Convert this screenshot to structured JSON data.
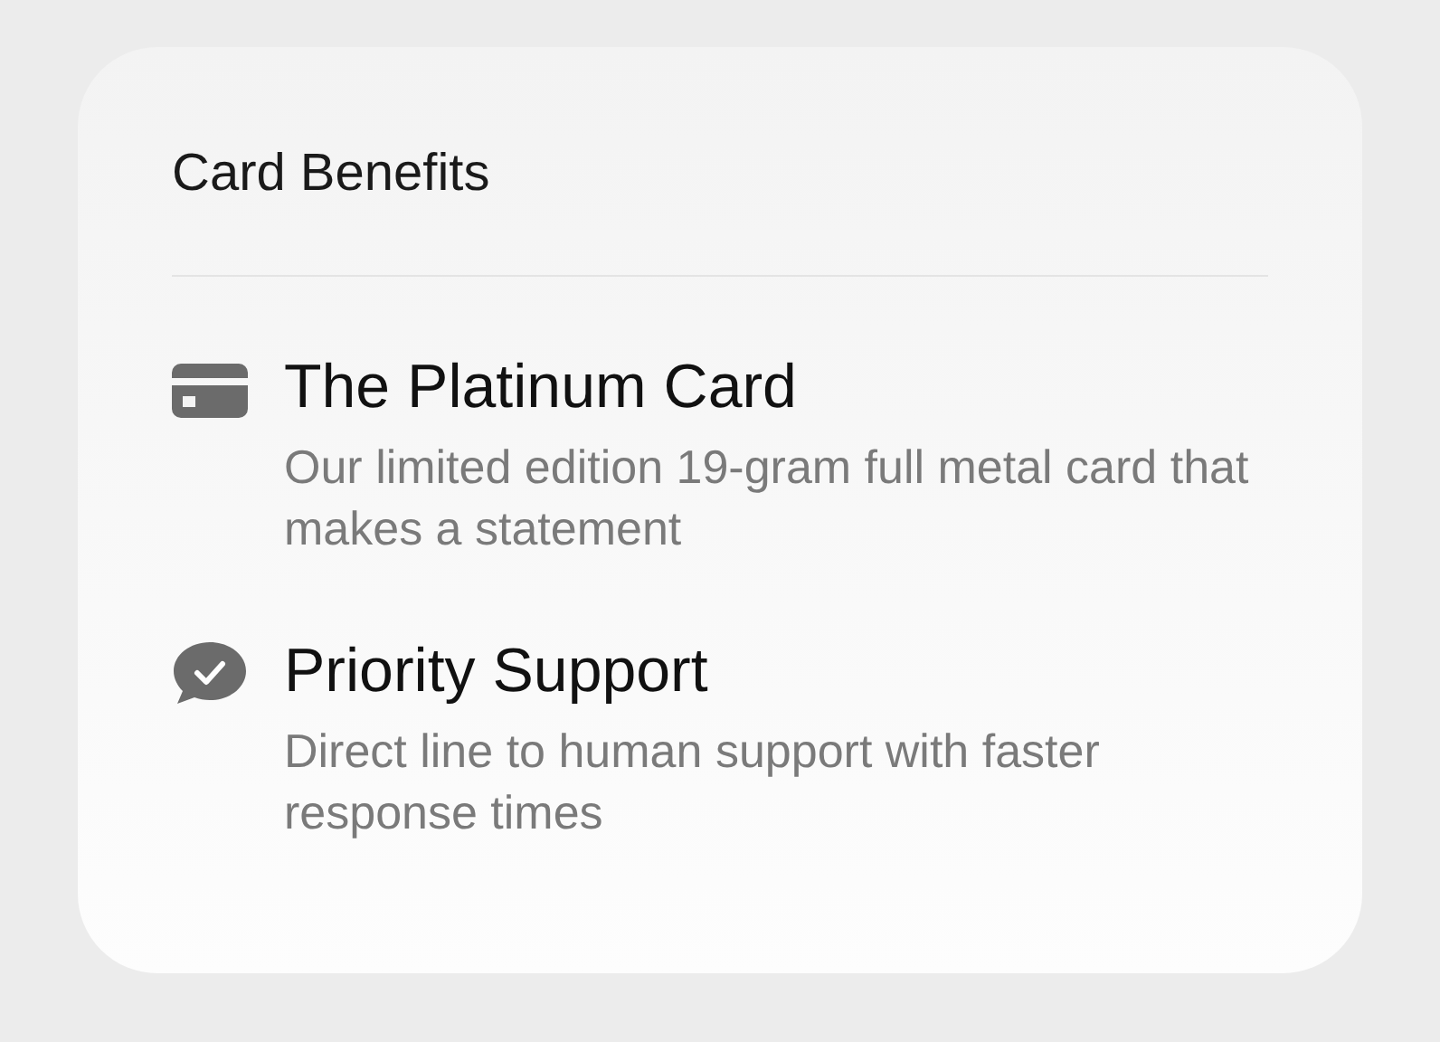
{
  "card": {
    "title": "Card Benefits",
    "benefits": [
      {
        "kind": "card",
        "title": "The Platinum Card",
        "description": "Our limited edition 19-gram full metal card that makes a statement"
      },
      {
        "kind": "support",
        "title": "Priority Support",
        "description": "Direct line to human support with faster response times"
      }
    ]
  }
}
